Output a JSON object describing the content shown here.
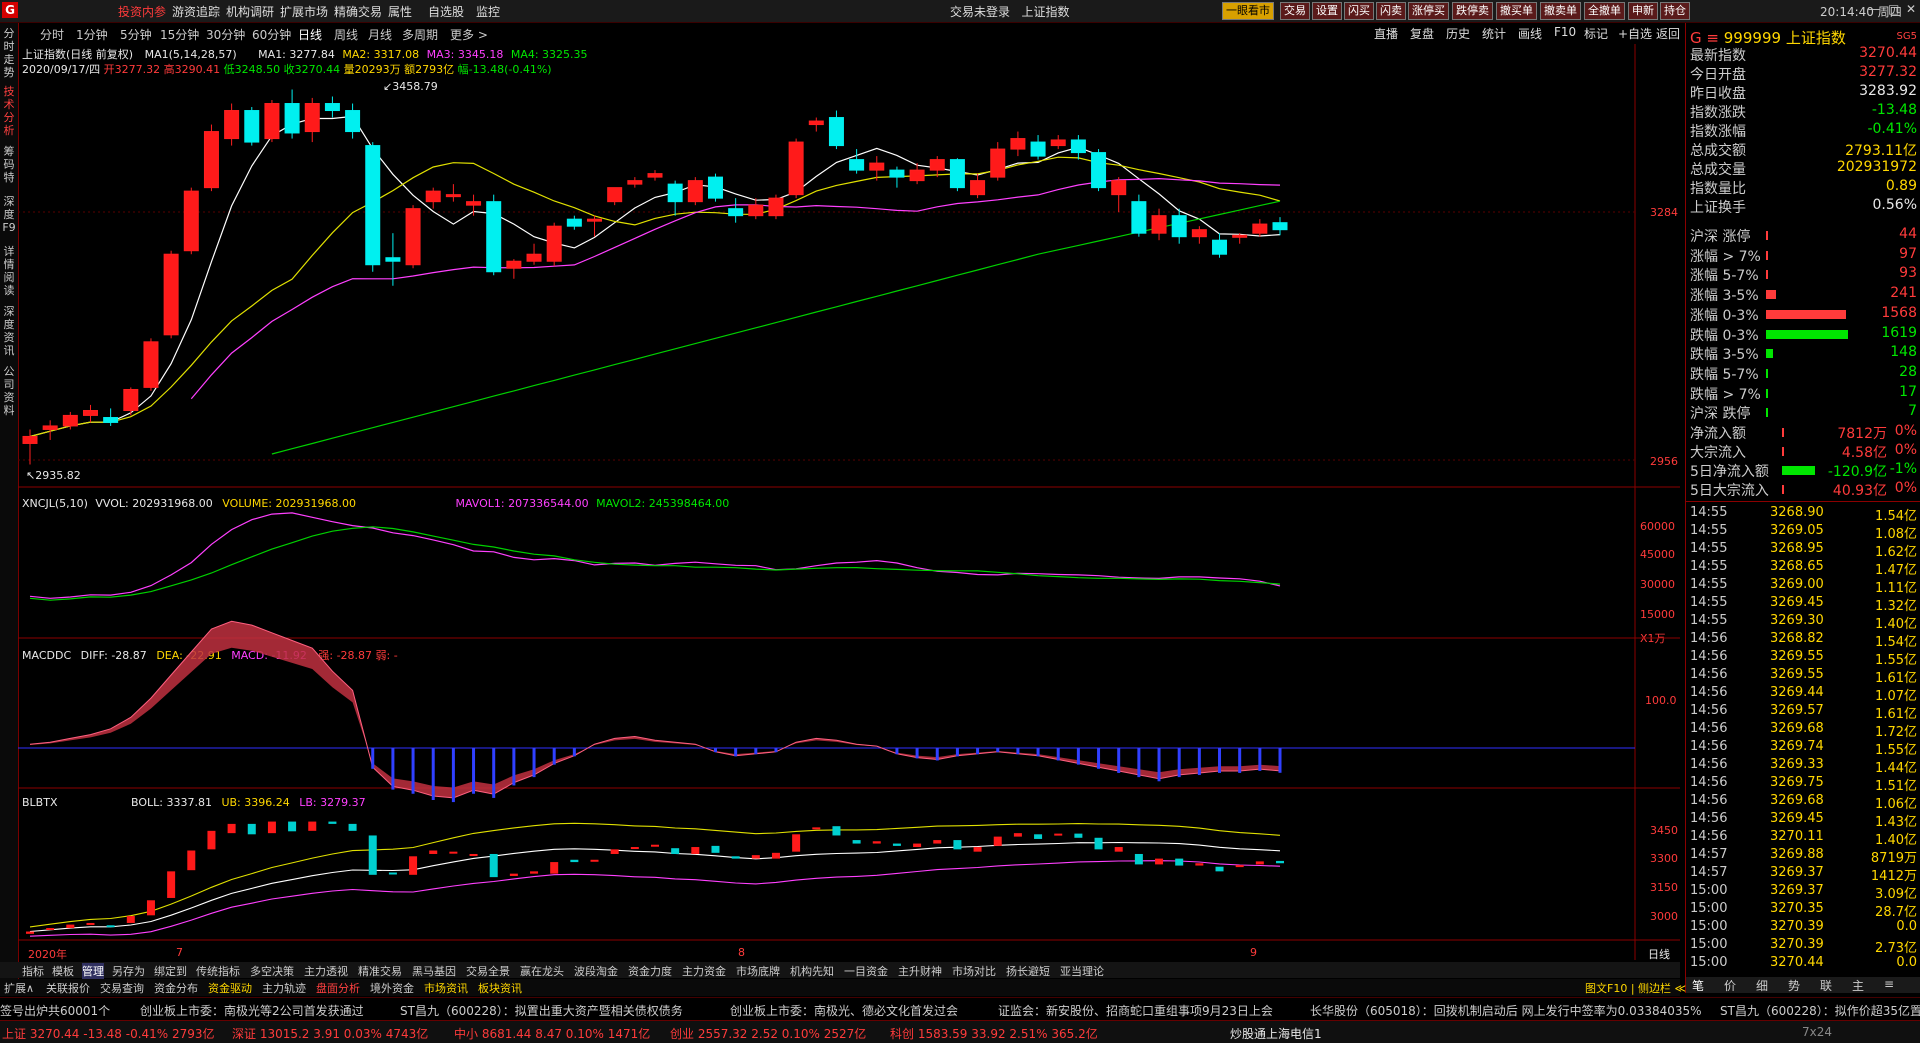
{
  "app": {
    "logo": "G",
    "menu": [
      "投资内参",
      "游资追踪",
      "机构调研",
      "扩展市场",
      "精确交易",
      "属性",
      "自选股",
      "监控"
    ],
    "login_status": "交易未登录",
    "window_title": "上证指数",
    "right_buttons": [
      "一眼看市",
      "交易",
      "设置",
      "闪买",
      "闪卖",
      "涨停买",
      "跌停卖",
      "撤买单",
      "撤卖单",
      "全撤单",
      "申新",
      "持仓"
    ],
    "clock": "20:14:40 周四"
  },
  "left_tabs": [
    "分时走势",
    "技术分析",
    "筹码特",
    "深度F9",
    "详情阅读",
    "深度资讯",
    "公司资料"
  ],
  "period_tabs": [
    "分时",
    "1分钟",
    "5分钟",
    "15分钟",
    "30分钟",
    "60分钟",
    "日线",
    "周线",
    "月线",
    "多周期",
    "更多 >"
  ],
  "active_period": "日线",
  "right_tools": [
    "直播",
    "复盘",
    "历史",
    "统计",
    "画线",
    "F10",
    "标记",
    "+自选",
    "返回"
  ],
  "main_chart": {
    "title": "上证指数(日线 前复权)",
    "ma_label": "MA1(5,14,28,57)",
    "ma1": "MA1: 3277.84",
    "ma2": "MA2: 3317.08",
    "ma3": "MA3: 3345.18",
    "ma4": "MA4: 3325.35",
    "info_date": "2020/09/17/四",
    "info_open": "开3277.32",
    "info_high": "高3290.41",
    "info_low": "低3248.50",
    "info_close": "收3270.44",
    "info_vol": "量20293万",
    "info_amt": "额2793亿",
    "info_chg": "幅-13.48(-0.41%)",
    "high_mark": "3458.79",
    "low_mark": "2935.82",
    "y_ticks": [
      "3284",
      "2956"
    ]
  },
  "volume_panel": {
    "name": "XNCJL(5,10)",
    "vvol": "VVOL: 202931968.00",
    "volume": "VOLUME: 202931968.00",
    "mavol1": "MAVOL1: 207336544.00",
    "mavol2": "MAVOL2: 245398464.00",
    "y_ticks": [
      "60000",
      "45000",
      "30000",
      "15000"
    ],
    "unit": "X1万"
  },
  "macd_panel": {
    "name": "MACDDC",
    "diff": "DIFF: -28.87",
    "dea": "DEA: -22.91",
    "macd": "MACD: -11.92",
    "extra": "强: -28.87 弱: -",
    "y_ticks": [
      "100.0"
    ]
  },
  "boll_panel": {
    "name": "BLBTX",
    "boll": "BOLL: 3337.81",
    "ub": "UB: 3396.24",
    "lb": "LB: 3279.37",
    "y_ticks": [
      "3450",
      "3300",
      "3150",
      "3000"
    ]
  },
  "x_axis": {
    "labels": [
      "2020年",
      "7",
      "8",
      "9"
    ],
    "right": "日线"
  },
  "chart_data": {
    "type": "candlestick",
    "title": "上证指数(日线 前复权)",
    "date_range": [
      "2020-06-29",
      "2020-09-17"
    ],
    "ohlc": [
      [
        2965,
        2985,
        2935,
        2975
      ],
      [
        2985,
        2998,
        2970,
        2990
      ],
      [
        2990,
        3010,
        2985,
        3005
      ],
      [
        3005,
        3020,
        2995,
        3012
      ],
      [
        3002,
        3015,
        2990,
        2995
      ],
      [
        3012,
        3045,
        3005,
        3042
      ],
      [
        3045,
        3115,
        3040,
        3110
      ],
      [
        3120,
        3240,
        3115,
        3235
      ],
      [
        3240,
        3330,
        3235,
        3325
      ],
      [
        3330,
        3420,
        3325,
        3410
      ],
      [
        3400,
        3450,
        3390,
        3440
      ],
      [
        3440,
        3445,
        3390,
        3395
      ],
      [
        3400,
        3455,
        3395,
        3450
      ],
      [
        3450,
        3470,
        3400,
        3408
      ],
      [
        3410,
        3458,
        3395,
        3450
      ],
      [
        3450,
        3460,
        3430,
        3440
      ],
      [
        3440,
        3450,
        3400,
        3410
      ],
      [
        3390,
        3395,
        3210,
        3220
      ],
      [
        3230,
        3265,
        3190,
        3225
      ],
      [
        3220,
        3305,
        3215,
        3300
      ],
      [
        3310,
        3330,
        3300,
        3325
      ],
      [
        3320,
        3335,
        3310,
        3320
      ],
      [
        3305,
        3320,
        3290,
        3310
      ],
      [
        3310,
        3320,
        3205,
        3210
      ],
      [
        3215,
        3228,
        3200,
        3225
      ],
      [
        3225,
        3250,
        3220,
        3235
      ],
      [
        3225,
        3280,
        3218,
        3275
      ],
      [
        3285,
        3290,
        3270,
        3275
      ],
      [
        3285,
        3290,
        3260,
        3285
      ],
      [
        3310,
        3330,
        3305,
        3330
      ],
      [
        3335,
        3345,
        3330,
        3340
      ],
      [
        3345,
        3355,
        3340,
        3350
      ],
      [
        3335,
        3340,
        3290,
        3310
      ],
      [
        3310,
        3345,
        3305,
        3340
      ],
      [
        3345,
        3350,
        3310,
        3315
      ],
      [
        3300,
        3315,
        3280,
        3290
      ],
      [
        3290,
        3315,
        3285,
        3305
      ],
      [
        3290,
        3320,
        3285,
        3315
      ],
      [
        3320,
        3400,
        3315,
        3395
      ],
      [
        3420,
        3430,
        3410,
        3425
      ],
      [
        3430,
        3440,
        3385,
        3390
      ],
      [
        3370,
        3385,
        3350,
        3355
      ],
      [
        3355,
        3375,
        3340,
        3365
      ],
      [
        3355,
        3360,
        3330,
        3345
      ],
      [
        3340,
        3365,
        3335,
        3355
      ],
      [
        3355,
        3375,
        3345,
        3370
      ],
      [
        3370,
        3372,
        3325,
        3330
      ],
      [
        3320,
        3350,
        3315,
        3340
      ],
      [
        3345,
        3395,
        3340,
        3385
      ],
      [
        3385,
        3410,
        3375,
        3400
      ],
      [
        3395,
        3405,
        3370,
        3375
      ],
      [
        3390,
        3405,
        3385,
        3398
      ],
      [
        3398,
        3405,
        3370,
        3380
      ],
      [
        3380,
        3385,
        3325,
        3330
      ],
      [
        3320,
        3345,
        3295,
        3340
      ],
      [
        3310,
        3320,
        3260,
        3265
      ],
      [
        3265,
        3300,
        3255,
        3290
      ],
      [
        3290,
        3300,
        3250,
        3260
      ],
      [
        3260,
        3275,
        3250,
        3270
      ],
      [
        3255,
        3265,
        3230,
        3235
      ],
      [
        3260,
        3265,
        3250,
        3262
      ],
      [
        3265,
        3285,
        3260,
        3278
      ],
      [
        3280,
        3288,
        3262,
        3270
      ]
    ],
    "volume_wan": [
      20000,
      18000,
      21000,
      24000,
      20000,
      27000,
      35000,
      48000,
      55000,
      66000,
      64000,
      60000,
      62000,
      58000,
      55000,
      53000,
      50000,
      56000,
      46000,
      48000,
      42000,
      38000,
      40000,
      44000,
      34000,
      36000,
      41000,
      35000,
      33000,
      38000,
      37000,
      35000,
      40000,
      36000,
      34000,
      33000,
      34000,
      30000,
      38000,
      42000,
      40000,
      36000,
      34000,
      32000,
      30000,
      31000,
      33000,
      29000,
      31000,
      34000,
      30000,
      31000,
      28000,
      29000,
      30000,
      28000,
      30000,
      32000,
      29000,
      27000,
      26000,
      24000,
      20293
    ],
    "macd": [
      2,
      3,
      5,
      7,
      10,
      16,
      26,
      38,
      50,
      62,
      66,
      64,
      60,
      56,
      52,
      40,
      30,
      -10,
      -20,
      -22,
      -25,
      -26,
      -22,
      -24,
      -18,
      -14,
      -8,
      -4,
      2,
      5,
      6,
      4,
      3,
      2,
      -2,
      -4,
      -3,
      -2,
      3,
      5,
      4,
      2,
      1,
      -3,
      -5,
      -6,
      -4,
      -3,
      -2,
      -3,
      -4,
      -6,
      -8,
      -10,
      -12,
      -14,
      -16,
      -14,
      -13,
      -12,
      -12,
      -11,
      -11.92
    ],
    "legend": [
      "MA1",
      "MA2",
      "MA3",
      "MA4"
    ]
  },
  "quote": {
    "code": "999999",
    "name": "上证指数",
    "tag": "SG5",
    "rows": [
      {
        "label": "最新指数",
        "value": "3270.44",
        "color": "#ff3b3b"
      },
      {
        "label": "今日开盘",
        "value": "3277.32",
        "color": "#ff3b3b"
      },
      {
        "label": "昨日收盘",
        "value": "3283.92",
        "color": "#e8e8e8"
      },
      {
        "label": "指数涨跌",
        "value": "-13.48",
        "color": "#00e600"
      },
      {
        "label": "指数涨幅",
        "value": "-0.41%",
        "color": "#00e600"
      },
      {
        "label": "总成交额",
        "value": "2793.11亿",
        "color": "#ffd700"
      },
      {
        "label": "总成交量",
        "value": "202931972",
        "color": "#ffd700"
      },
      {
        "label": "指数量比",
        "value": "0.89",
        "color": "#ffd700"
      },
      {
        "label": "上证换手",
        "value": "0.56%",
        "color": "#e8e8e8"
      }
    ],
    "breadth": [
      {
        "label": "沪深 涨停",
        "value": "44",
        "color": "#ff3b3b",
        "frac": 0.015
      },
      {
        "label": "涨幅 > 7%",
        "value": "97",
        "color": "#ff3b3b",
        "frac": 0.02
      },
      {
        "label": "涨幅 5-7%",
        "value": "93",
        "color": "#ff3b3b",
        "frac": 0.02
      },
      {
        "label": "涨幅 3-5%",
        "value": "241",
        "color": "#ff3b3b",
        "frac": 0.12
      },
      {
        "label": "涨幅 0-3%",
        "value": "1568",
        "color": "#ff3b3b",
        "frac": 0.97
      },
      {
        "label": "跌幅 0-3%",
        "value": "1619",
        "color": "#00e600",
        "frac": 1.0
      },
      {
        "label": "跌幅 3-5%",
        "value": "148",
        "color": "#00e600",
        "frac": 0.09
      },
      {
        "label": "跌幅 5-7%",
        "value": "28",
        "color": "#00e600",
        "frac": 0.015
      },
      {
        "label": "跌幅 > 7%",
        "value": "17",
        "color": "#00e600",
        "frac": 0.01
      },
      {
        "label": "沪深 跌停",
        "value": "7",
        "color": "#00e600",
        "frac": 0.005
      }
    ],
    "flows": [
      {
        "label": "净流入额",
        "value": "7812万",
        "pct": "0%",
        "color": "#ff3b3b",
        "frac": 0.01
      },
      {
        "label": "大宗流入",
        "value": "4.58亿",
        "pct": "0%",
        "color": "#ff3b3b",
        "frac": 0.01
      },
      {
        "label": "5日净流入额",
        "value": "-120.9亿",
        "pct": "-1%",
        "color": "#00e600",
        "frac": 0.55
      },
      {
        "label": "5日大宗流入",
        "value": "40.93亿",
        "pct": "0%",
        "color": "#ff3b3b",
        "frac": 0.01
      }
    ],
    "ticks": [
      [
        "14:55",
        "3268.90",
        "1.54亿"
      ],
      [
        "14:55",
        "3269.05",
        "1.08亿"
      ],
      [
        "14:55",
        "3268.95",
        "1.62亿"
      ],
      [
        "14:55",
        "3268.65",
        "1.47亿"
      ],
      [
        "14:55",
        "3269.00",
        "1.11亿"
      ],
      [
        "14:55",
        "3269.45",
        "1.32亿"
      ],
      [
        "14:55",
        "3269.30",
        "1.40亿"
      ],
      [
        "14:56",
        "3268.82",
        "1.54亿"
      ],
      [
        "14:56",
        "3269.55",
        "1.55亿"
      ],
      [
        "14:56",
        "3269.55",
        "1.61亿"
      ],
      [
        "14:56",
        "3269.44",
        "1.07亿"
      ],
      [
        "14:56",
        "3269.57",
        "1.61亿"
      ],
      [
        "14:56",
        "3269.68",
        "1.72亿"
      ],
      [
        "14:56",
        "3269.74",
        "1.55亿"
      ],
      [
        "14:56",
        "3269.33",
        "1.44亿"
      ],
      [
        "14:56",
        "3269.75",
        "1.51亿"
      ],
      [
        "14:56",
        "3269.68",
        "1.06亿"
      ],
      [
        "14:56",
        "3269.45",
        "1.43亿"
      ],
      [
        "14:56",
        "3270.11",
        "1.40亿"
      ],
      [
        "14:57",
        "3269.88",
        "8719万"
      ],
      [
        "14:57",
        "3269.37",
        "1412万"
      ],
      [
        "15:00",
        "3269.37",
        "3.09亿"
      ],
      [
        "15:00",
        "3270.35",
        "28.7亿"
      ],
      [
        "15:00",
        "3270.39",
        "0.0"
      ],
      [
        "15:00",
        "3270.39",
        "2.73亿"
      ],
      [
        "15:00",
        "3270.44",
        "0.0"
      ]
    ],
    "bottom_tabs": [
      "笔",
      "价",
      "细",
      "势",
      "联",
      "主",
      "≡"
    ]
  },
  "indicator_tabs": [
    "指标",
    "模板",
    "管理",
    "另存为",
    "绑定到",
    "传统指标",
    "多空决策",
    "主力透视",
    "精准交易",
    "黑马基因",
    "交易全景",
    "赢在龙头",
    "波段淘金",
    "资金力度",
    "主力资金",
    "市场底牌",
    "机构先知",
    "一目资金",
    "主升财神",
    "市场对比",
    "扬长避短",
    "亚当理论"
  ],
  "view_tabs": [
    "扩展∧",
    "关联报价",
    "交易查询",
    "资金分布",
    "资金驱动",
    "主力轨迹",
    "盘面分析",
    "境外资金",
    "市场资讯",
    "板块资讯"
  ],
  "view_right": "图文F10 | 侧边栏 ≪",
  "news": [
    "签号出炉共60001个",
    "创业板上市委：南极光等2公司首发获通过",
    "ST昌九（600228）：拟置出重大资产暨相关债权债务",
    "创业板上市委：南极光、德必文化首发过会",
    "证监会：新安股份、招商蛇口重组事项9月23日上会",
    "长华股份（605018）：回拨机制启动后 网上发行中签率为0.03384035%",
    "ST昌九（600228）：拟作价超35亿置"
  ],
  "status": {
    "sh": "上证 3270.44 -13.48 -0.41% 2793亿",
    "sz": "深证 13015.2 3.91 0.03% 4743亿",
    "zx": "中小 8681.44 8.47 0.10% 1471亿",
    "cy": "创业 2557.32 2.52 0.10% 2527亿",
    "kc": "科创 1583.59 33.92 2.51% 365.2亿",
    "ticker": "炒股通上海电信1",
    "size": "7x24"
  }
}
